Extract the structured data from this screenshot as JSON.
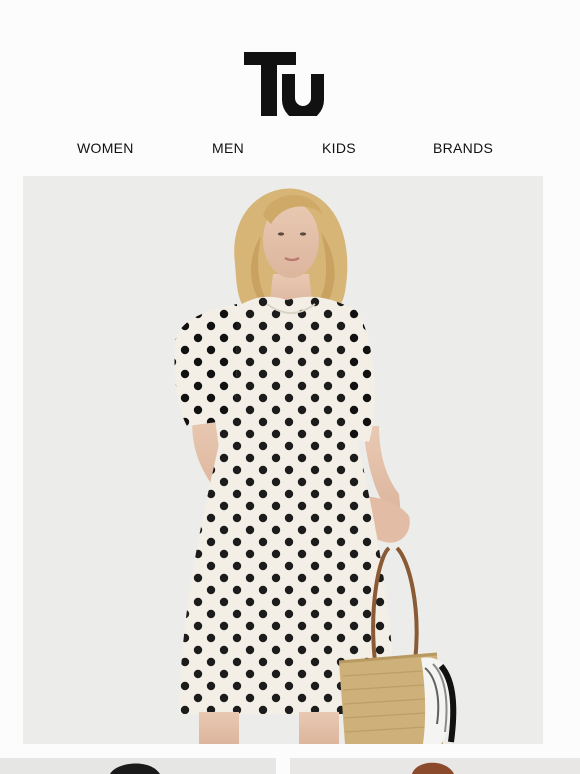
{
  "brand": {
    "logo_text": "Tu",
    "logo_color": "#111111"
  },
  "nav": {
    "items": [
      {
        "label": "WOMEN"
      },
      {
        "label": "MEN"
      },
      {
        "label": "KIDS"
      },
      {
        "label": "BRANDS"
      }
    ]
  },
  "hero": {
    "image_subject": "model-polka-dot-dress",
    "background_color": "#eeeeec",
    "dress_color": "#f3efe6",
    "dot_color": "#111111",
    "hair_color": "#d8b77a"
  },
  "thumbnails": [
    {
      "subject": "model-dark-hair"
    },
    {
      "subject": "model-red-hair"
    }
  ]
}
